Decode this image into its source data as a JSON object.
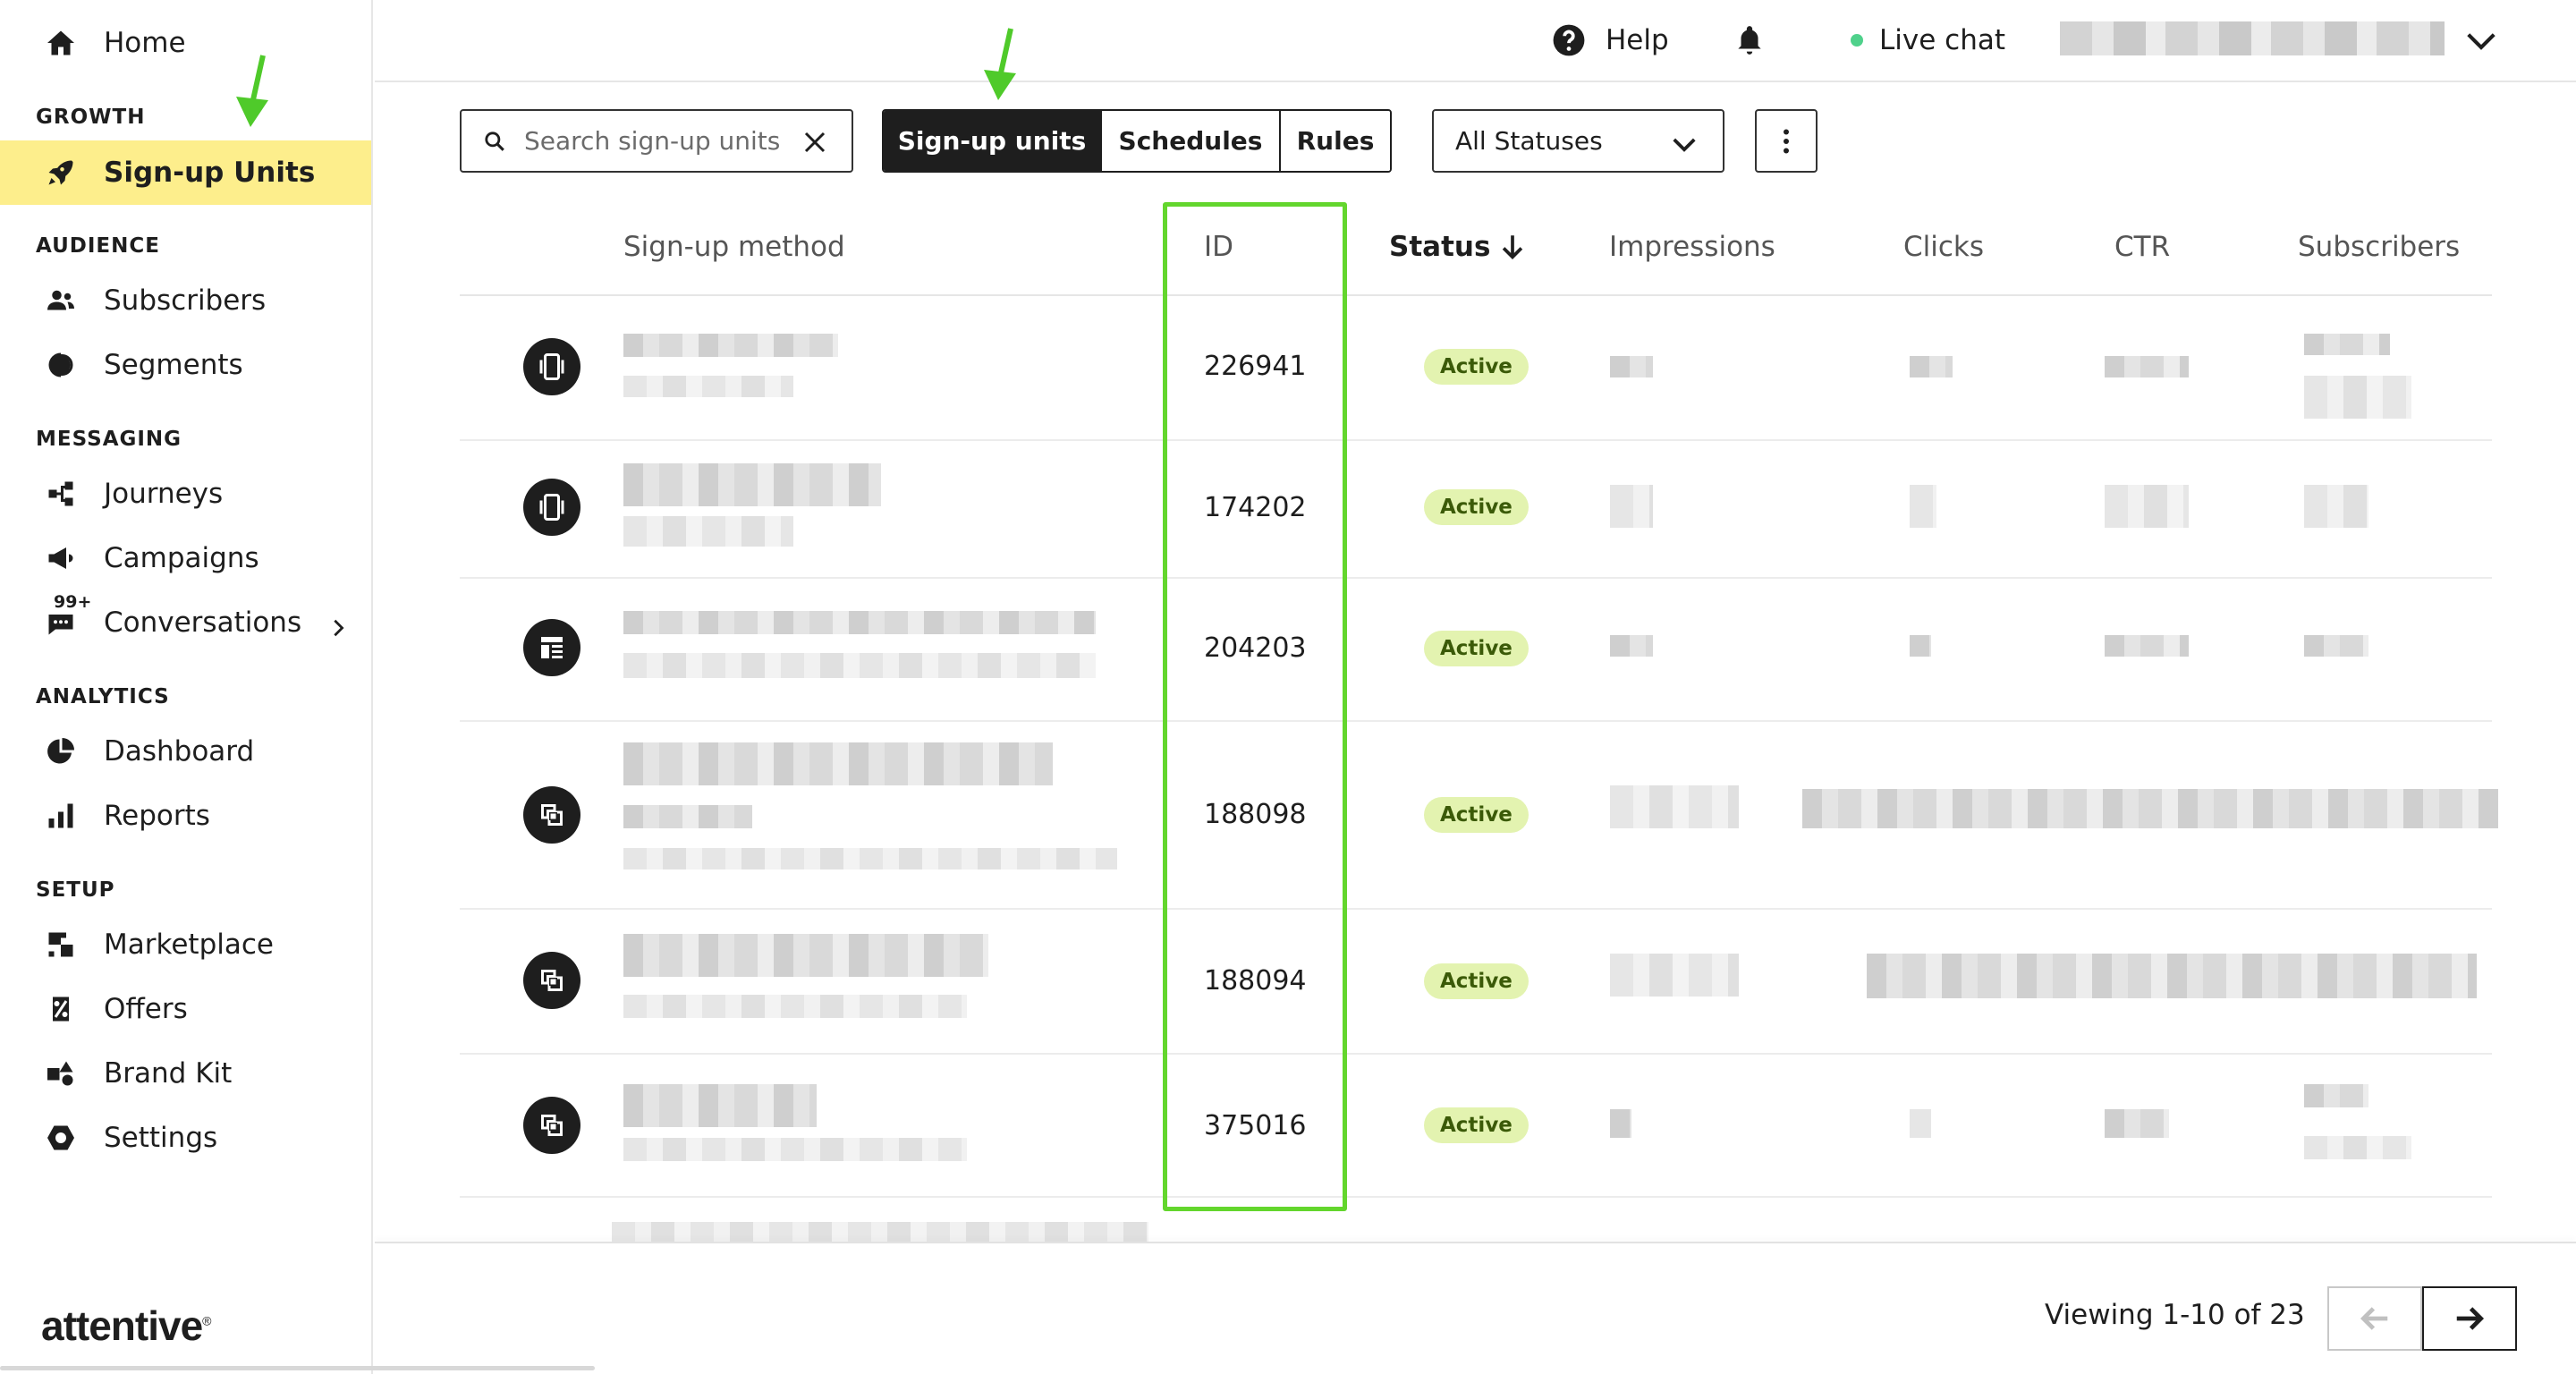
{
  "sidebar": {
    "home": "Home",
    "sections": {
      "growth": "GROWTH",
      "audience": "AUDIENCE",
      "messaging": "MESSAGING",
      "analytics": "ANALYTICS",
      "setup": "SETUP"
    },
    "items": {
      "signup_units": "Sign-up Units",
      "subscribers": "Subscribers",
      "segments": "Segments",
      "journeys": "Journeys",
      "campaigns": "Campaigns",
      "conversations": "Conversations",
      "conversations_badge": "99+",
      "dashboard": "Dashboard",
      "reports": "Reports",
      "marketplace": "Marketplace",
      "offers": "Offers",
      "brand_kit": "Brand Kit",
      "settings": "Settings"
    },
    "logo": "attentive",
    "logo_mark": "®",
    "active_color": "#fdee8c"
  },
  "topbar": {
    "help": "Help",
    "live_chat": "Live chat"
  },
  "toolbar": {
    "search_placeholder": "Search sign-up units",
    "tabs": [
      "Sign-up units",
      "Schedules",
      "Rules"
    ],
    "status_filter": "All Statuses"
  },
  "table": {
    "headers": {
      "method": "Sign-up method",
      "id": "ID",
      "status": "Status",
      "impressions": "Impressions",
      "clicks": "Clicks",
      "ctr": "CTR",
      "subscribers": "Subscribers"
    },
    "rows": [
      {
        "icon": "mobile-icon",
        "id": "226941",
        "status": "Active"
      },
      {
        "icon": "mobile-icon",
        "id": "174202",
        "status": "Active"
      },
      {
        "icon": "form-layout-icon",
        "id": "204203",
        "status": "Active"
      },
      {
        "icon": "integration-icon",
        "id": "188098",
        "status": "Active"
      },
      {
        "icon": "integration-icon",
        "id": "188094",
        "status": "Active"
      },
      {
        "icon": "integration-icon",
        "id": "375016",
        "status": "Active"
      }
    ]
  },
  "pagination": {
    "text": "Viewing 1-10 of 23"
  },
  "colors": {
    "highlight": "#63d62d",
    "status_pill": "#e3f3b0",
    "live_dot": "#4fd18b"
  }
}
